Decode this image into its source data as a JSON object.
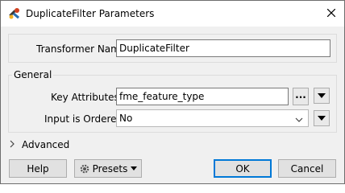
{
  "window": {
    "title": "DuplicateFilter Parameters"
  },
  "transformer": {
    "label": "Transformer Name:",
    "value": "DuplicateFilter"
  },
  "general": {
    "legend": "General",
    "key_attributes": {
      "label": "Key Attributes:",
      "value": "fme_feature_type",
      "ellipsis": "..."
    },
    "input_ordered": {
      "label": "Input is Ordered:",
      "value": "No"
    }
  },
  "advanced": {
    "label": "Advanced"
  },
  "buttons": {
    "help": "Help",
    "presets": "Presets",
    "ok": "OK",
    "cancel": "Cancel"
  },
  "colors": {
    "accent": "#0078d7",
    "dialog_bg": "#f0f0f0"
  }
}
